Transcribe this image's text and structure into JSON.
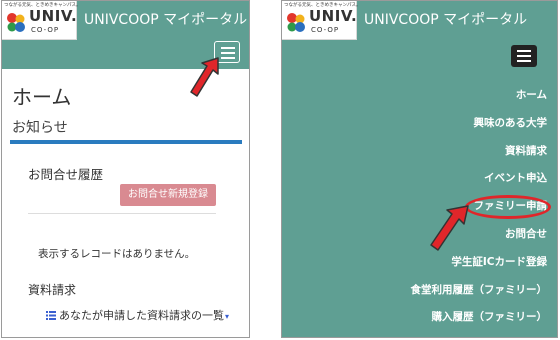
{
  "brand": {
    "tagline": "つながる元気、ときめきキャンパス。",
    "wordmark": "UNIV.",
    "sub_wordmark": "CO-OP",
    "app_title": "UNIVCOOP マイポータル"
  },
  "left": {
    "page_heading": "ホーム",
    "section_title": "お知らせ",
    "inquiry_heading": "お問合せ履歴",
    "new_inquiry_button": "お問合せ新規登録",
    "empty_message": "表示するレコードはありません。",
    "request_heading": "資料請求",
    "request_link": "あなたが申請した資料請求の一覧",
    "request_link_caret": "▾"
  },
  "menu": {
    "items": [
      "ホーム",
      "興味のある大学",
      "資料請求",
      "イベント申込",
      "ファミリー申請",
      "お問合せ",
      "学生証ICカード登録",
      "食堂利用履歴（ファミリー）",
      "購入履歴（ファミリー）"
    ],
    "highlighted_item": "ファミリー申請"
  },
  "colors": {
    "header_bg": "#5f9f93",
    "accent_rule": "#2a7bbf",
    "button_bg": "#d98a91",
    "annotation_red": "#e0262a"
  },
  "icons": {
    "menu": "hamburger-icon",
    "list": "list-icon",
    "annotation": "red-arrow"
  }
}
